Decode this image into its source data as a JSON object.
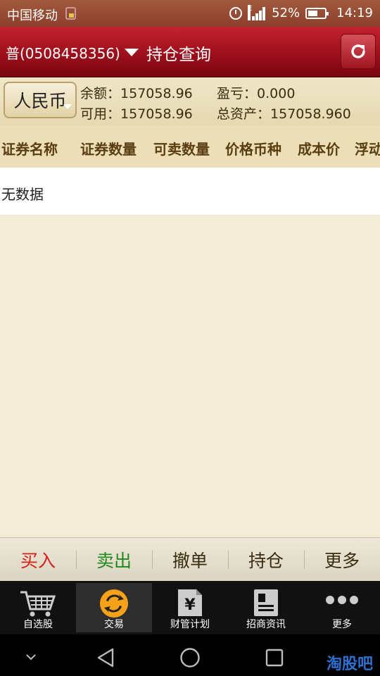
{
  "status": {
    "carrier": "中国移动",
    "battery": "52%",
    "time": "14:19"
  },
  "titlebar": {
    "account": "普(0508458356)",
    "title": "持仓查询"
  },
  "account_info": {
    "currency": "人民币",
    "balance_label": "余额：",
    "balance": "157058.96",
    "pnl_label": "盈亏：",
    "pnl": "0.000",
    "available_label": "可用：",
    "available": "157058.96",
    "total_label": "总资产：",
    "total": "157058.960"
  },
  "columns": [
    "证券名称",
    "证券数量",
    "可卖数量",
    "价格币种",
    "成本价",
    "浮动"
  ],
  "empty_text": "无数据",
  "actions": [
    {
      "label": "买入",
      "color": "#d8201a"
    },
    {
      "label": "卖出",
      "color": "#1e8a1e"
    },
    {
      "label": "撤单",
      "color": "#3a2d10"
    },
    {
      "label": "持仓",
      "color": "#3a2d10"
    },
    {
      "label": "更多",
      "color": "#3a2d10"
    }
  ],
  "tabs": [
    {
      "label": "自选股",
      "icon": "cart-icon"
    },
    {
      "label": "交易",
      "icon": "exchange-icon",
      "active": true
    },
    {
      "label": "财管计划",
      "icon": "yuan-doc-icon"
    },
    {
      "label": "招商资讯",
      "icon": "news-icon"
    },
    {
      "label": "更多",
      "icon": "more-dots-icon"
    }
  ],
  "watermark": "淘股吧"
}
